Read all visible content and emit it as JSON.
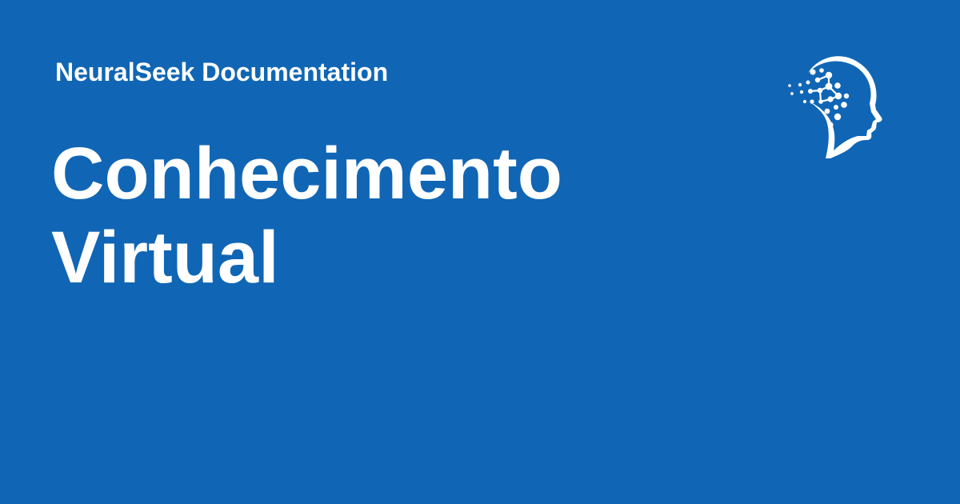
{
  "card": {
    "site_name": "NeuralSeek Documentation",
    "title_lines": [
      "Conhecimento",
      "Virtual"
    ]
  },
  "logo": {
    "icon": "neuralseek-head-icon"
  },
  "colors": {
    "background": "#1066b5",
    "text": "#ffffff"
  }
}
